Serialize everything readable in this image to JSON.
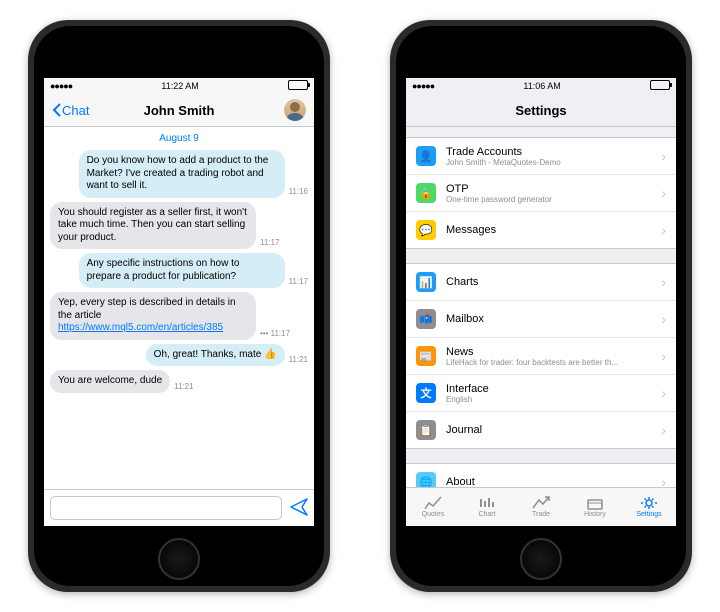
{
  "phone1": {
    "status": {
      "time": "11:22 AM"
    },
    "nav": {
      "back": "Chat",
      "title": "John Smith"
    },
    "date": "August 9",
    "messages": [
      {
        "dir": "out",
        "text": "Do you know how to add a product to the Market? I've created a trading robot and want to sell it.",
        "time": "11:16"
      },
      {
        "dir": "in",
        "text": "You should register as a seller first, it won't take much time. Then you can start selling your product.",
        "time": "11:17"
      },
      {
        "dir": "out",
        "text": "Any specific instructions on how to prepare a product for publication?",
        "time": "11:17"
      },
      {
        "dir": "in",
        "text": "Yep, every step is described in details in the article ",
        "link": "https://www.mql5.com/en/articles/385",
        "time": "••• 11:17"
      },
      {
        "dir": "out",
        "text": "Oh, great! Thanks, mate 👍",
        "time": "11:21"
      },
      {
        "dir": "in",
        "text": "You are welcome, dude",
        "time": "11:21"
      }
    ]
  },
  "phone2": {
    "status": {
      "time": "11:06 AM"
    },
    "nav": {
      "title": "Settings"
    },
    "groups": [
      [
        {
          "icon_bg": "#1e9df7",
          "icon": "person-icon",
          "title": "Trade Accounts",
          "sub": "John Smith - MetaQuotes-Demo"
        },
        {
          "icon_bg": "#4cd964",
          "icon": "lock-icon",
          "title": "OTP",
          "sub": "One-time password generator"
        },
        {
          "icon_bg": "#ffcc00",
          "icon": "messages-icon",
          "title": "Messages",
          "sub": ""
        }
      ],
      [
        {
          "icon_bg": "#1e9df7",
          "icon": "chart-icon",
          "title": "Charts",
          "sub": ""
        },
        {
          "icon_bg": "#8e8e93",
          "icon": "mailbox-icon",
          "title": "Mailbox",
          "sub": ""
        },
        {
          "icon_bg": "#ff9500",
          "icon": "news-icon",
          "title": "News",
          "sub": "LifeHack for trader: four backtests are better th..."
        },
        {
          "icon_bg": "#007aff",
          "icon": "interface-icon",
          "title": "Interface",
          "sub": "English"
        },
        {
          "icon_bg": "#8e8e93",
          "icon": "journal-icon",
          "title": "Journal",
          "sub": ""
        }
      ],
      [
        {
          "icon_bg": "#5ac8fa",
          "icon": "about-icon",
          "title": "About",
          "sub": ""
        }
      ]
    ],
    "tabs": [
      {
        "label": "Quotes",
        "icon": "quotes-icon"
      },
      {
        "label": "Chart",
        "icon": "chart-tab-icon"
      },
      {
        "label": "Trade",
        "icon": "trade-icon"
      },
      {
        "label": "History",
        "icon": "history-icon"
      },
      {
        "label": "Settings",
        "icon": "settings-icon",
        "active": true
      }
    ]
  }
}
